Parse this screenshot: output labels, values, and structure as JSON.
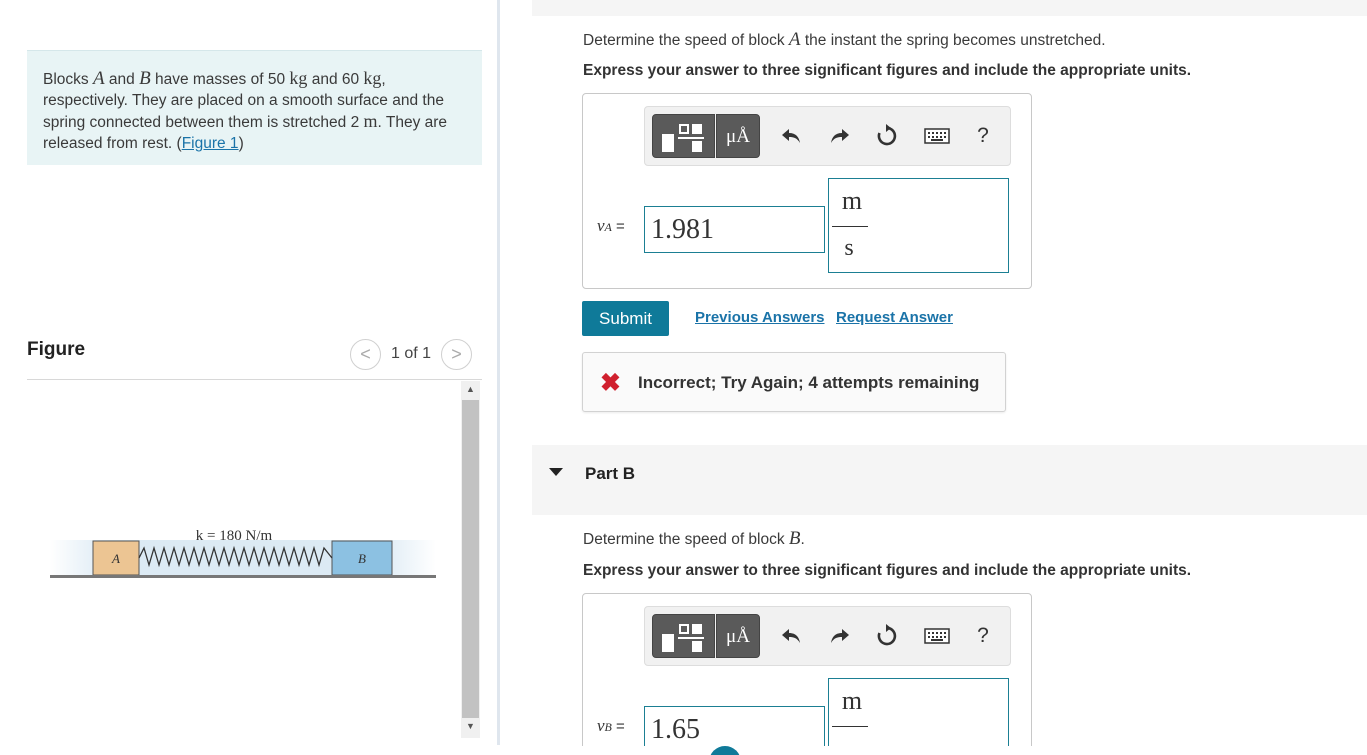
{
  "problem": {
    "pre1": "Blocks ",
    "varA": "A",
    "mid1": " and ",
    "varB": "B",
    "mid2": " have masses of 50 ",
    "unit_kg1": "kg",
    "mid3": " and 60 ",
    "unit_kg2": "kg",
    "mid4": ", respectively. They are placed on a smooth surface and the spring connected between them is stretched 2 ",
    "unit_m": "m",
    "mid5": ". They are released from rest. (",
    "figure_link": "Figure 1",
    "end": ")"
  },
  "figure_panel": {
    "title": "Figure",
    "pager": "1 of 1",
    "prev": "<",
    "next": ">",
    "spring_label": "k = 180 N/m",
    "block_a": "A",
    "block_b": "B"
  },
  "partA": {
    "q_pre": "Determine the speed of block ",
    "q_var": "A",
    "q_post": " the instant the spring becomes unstretched.",
    "instructions": "Express your answer to three significant figures and include the appropriate units.",
    "var_label": "v",
    "var_sub": "A",
    "equals": " =",
    "value": "1.981",
    "unit_num": "m",
    "unit_den": "s",
    "submit": "Submit",
    "previous_answers": "Previous Answers",
    "request_answer": "Request Answer",
    "feedback": "Incorrect; Try Again; 4 attempts remaining",
    "feedback_icon": "✖"
  },
  "toolbar": {
    "mu_label": "μÅ",
    "help": "?"
  },
  "partB": {
    "label": "Part B",
    "q_pre": "Determine the speed of block ",
    "q_var": "B",
    "q_post": ".",
    "instructions": "Express your answer to three significant figures and include the appropriate units.",
    "var_label": "v",
    "var_sub": "B",
    "equals": " =",
    "value": "1.65",
    "unit_num": "m"
  }
}
